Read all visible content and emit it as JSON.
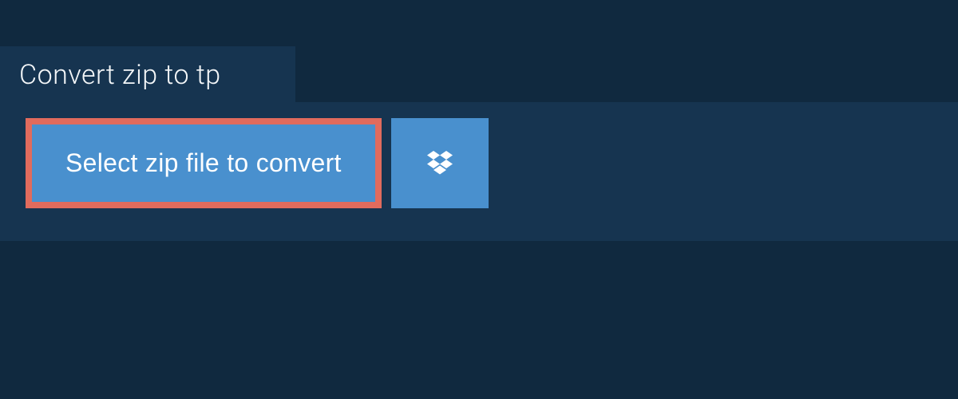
{
  "tab": {
    "title": "Convert zip to tp"
  },
  "actions": {
    "select_label": "Select zip file to convert"
  },
  "colors": {
    "page_bg": "#10293f",
    "panel_bg": "#163450",
    "button_bg": "#4990ce",
    "highlight_border": "#e16b5d"
  }
}
